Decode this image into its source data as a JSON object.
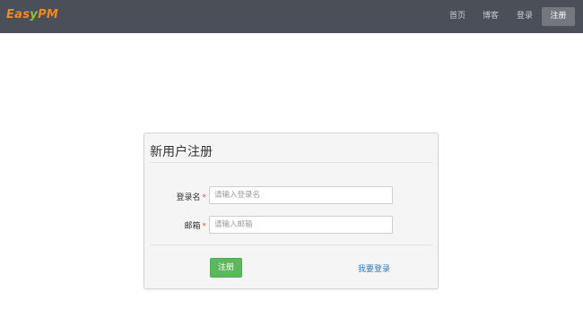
{
  "navbar": {
    "logo_prefix": "Eas",
    "logo_leaf": "y",
    "logo_suffix": "PM",
    "links": [
      "首页",
      "博客",
      "登录"
    ],
    "active_link": "注册"
  },
  "form": {
    "title": "新用户注册",
    "fields": [
      {
        "label": "登录名",
        "required_mark": "*",
        "placeholder": "请输入登录名",
        "value": ""
      },
      {
        "label": "邮箱",
        "required_mark": "*",
        "placeholder": "请输入邮箱",
        "value": ""
      }
    ],
    "submit_label": "注册",
    "login_link": "我要登录"
  },
  "colors": {
    "navbar_bg": "#4b4f57",
    "logo_orange": "#f08a24",
    "logo_green": "#8cc63f",
    "submit_green": "#5cb85c",
    "link_blue": "#337ab7",
    "required_red": "#d9534f"
  }
}
